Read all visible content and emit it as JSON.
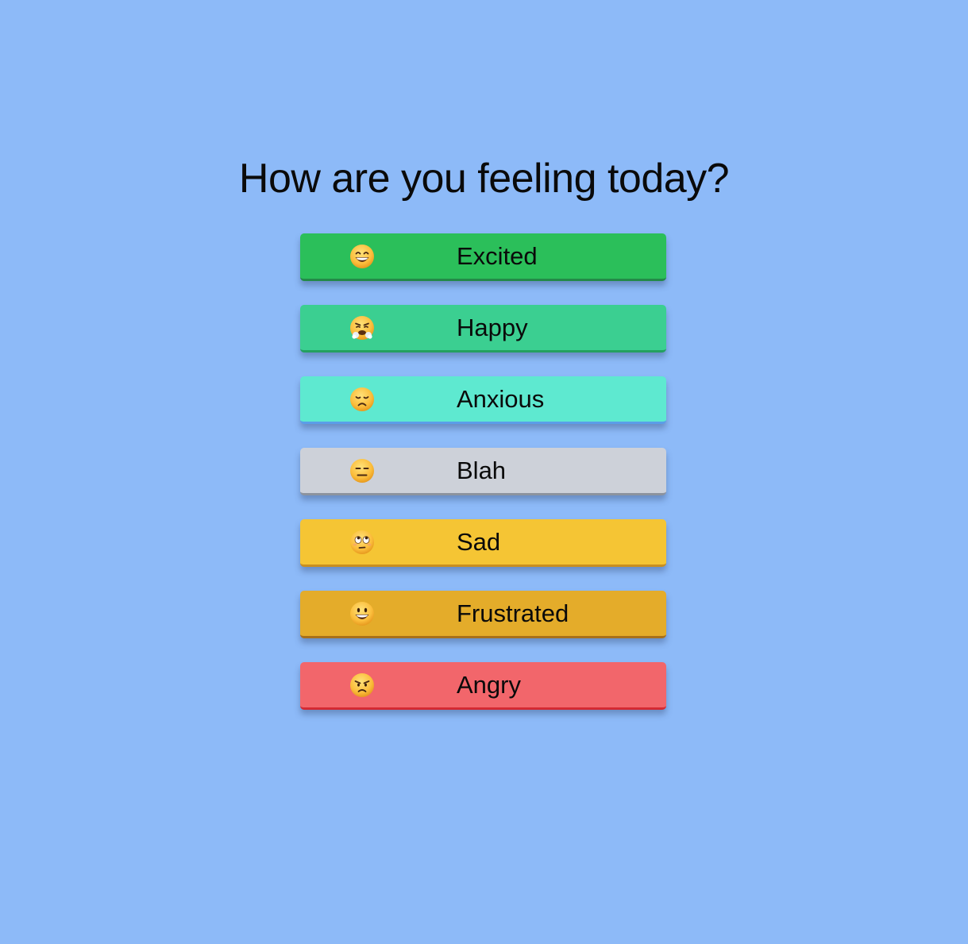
{
  "title": "How are you feeling today?",
  "moods": [
    {
      "label": "Excited",
      "icon": "grinning-face-icon",
      "color": "#2bbf5a",
      "edge": "#238a48"
    },
    {
      "label": "Happy",
      "icon": "face-with-steam-icon",
      "color": "#3bcf91",
      "edge": "#24a060"
    },
    {
      "label": "Anxious",
      "icon": "disappointed-face-icon",
      "color": "#5ee9d0",
      "edge": "#5a9ee8"
    },
    {
      "label": "Blah",
      "icon": "expressionless-face-icon",
      "color": "#cdd1d9",
      "edge": "#8c939e"
    },
    {
      "label": "Sad",
      "icon": "rolling-eyes-face-icon",
      "color": "#f5c534",
      "edge": "#c98f20"
    },
    {
      "label": "Frustrated",
      "icon": "smiling-face-icon",
      "color": "#e4ac2a",
      "edge": "#a8701a"
    },
    {
      "label": "Angry",
      "icon": "angry-face-icon",
      "color": "#f2666b",
      "edge": "#d42a33"
    }
  ]
}
